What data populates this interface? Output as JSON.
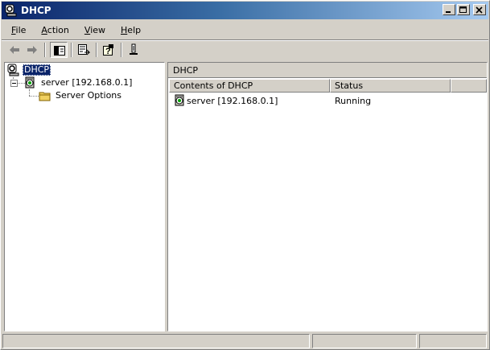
{
  "window": {
    "title": "DHCP",
    "icon": "dhcp-icon"
  },
  "caption_buttons": [
    {
      "name": "minimize",
      "icon": "minimize-icon"
    },
    {
      "name": "maximize",
      "icon": "maximize-icon"
    },
    {
      "name": "close",
      "icon": "close-icon"
    }
  ],
  "menu": {
    "file": {
      "accel": "F",
      "rest": "ile"
    },
    "action": {
      "accel": "A",
      "rest": "ction"
    },
    "view": {
      "accel": "V",
      "rest": "iew"
    },
    "help": {
      "accel": "H",
      "rest": "elp"
    }
  },
  "toolbar": {
    "items": [
      "back-arrow-icon",
      "forward-arrow-icon",
      "show-hide-tree-icon",
      "export-list-icon",
      "help-icon",
      "add-server-icon"
    ]
  },
  "tree": {
    "root": {
      "label": "DHCP",
      "icon": "dhcp-icon",
      "selected": true
    },
    "server": {
      "label": "server [192.168.0.1]",
      "icon": "server-icon",
      "expanded": true
    },
    "server_options": {
      "label": "Server Options",
      "icon": "folder-icon"
    }
  },
  "details": {
    "header": "DHCP",
    "columns": {
      "contents": "Contents of DHCP",
      "status": "Status"
    },
    "rows": [
      {
        "name": "server [192.168.0.1]",
        "status": "Running",
        "icon": "server-icon"
      }
    ]
  },
  "colors": {
    "title_gradient_start": "#0a246a",
    "title_gradient_end": "#a6caf0",
    "face": "#d4d0c8",
    "selection": "#0a246a"
  }
}
